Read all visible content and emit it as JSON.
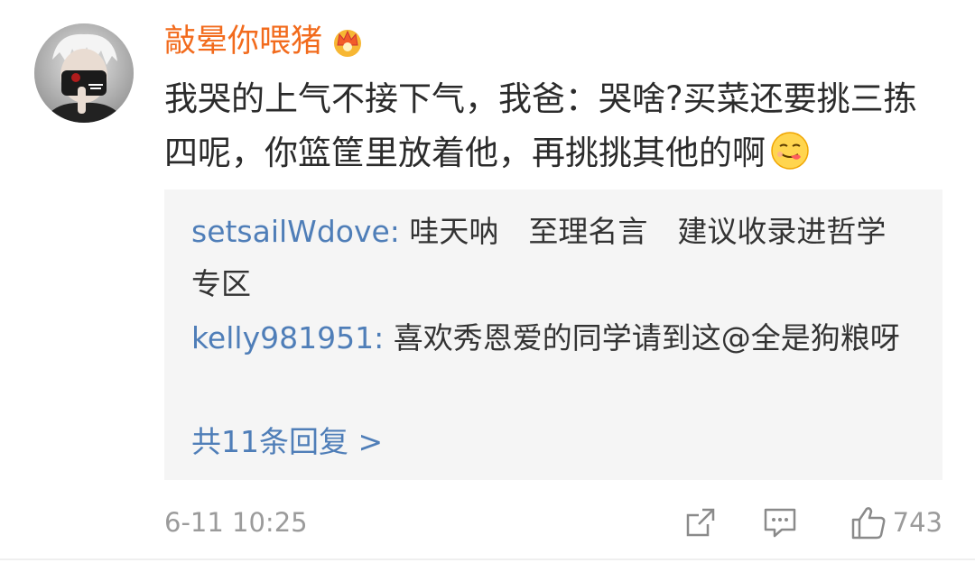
{
  "comment": {
    "username": "敲晕你喂猪",
    "badge_icon": "crown-badge-icon",
    "text": "我哭的上气不接下气，我爸：哭啥?买菜还要挑三拣四呢，你篮筐里放着他，再挑挑其他的啊",
    "emoji_icon": "tongue-out-emoji-icon"
  },
  "replies": [
    {
      "user": "setsailWdove:",
      "text": " 哇天呐　至理名言　建议收录进哲学专区"
    },
    {
      "user": "kelly981951:",
      "text": " 喜欢秀恩爱的同学请到这@全是狗粮呀"
    }
  ],
  "more_replies": "共11条回复 >",
  "footer": {
    "time": "6-11 10:25",
    "like_count": "743"
  },
  "colors": {
    "username": "#f26b1d",
    "link": "#4f7eb8",
    "muted": "#9b9b9b"
  }
}
